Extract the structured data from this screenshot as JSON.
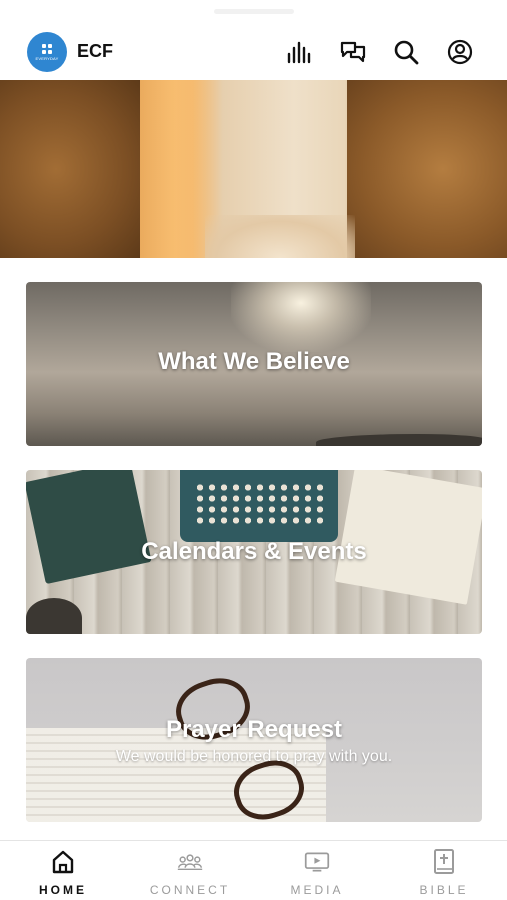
{
  "header": {
    "logo_text": "EVERYDAY",
    "title": "ECF",
    "icons": [
      "stats-icon",
      "chat-icon",
      "search-icon",
      "profile-icon"
    ]
  },
  "cards": [
    {
      "title": "What We Believe",
      "subtitle": ""
    },
    {
      "title": "Calendars & Events",
      "subtitle": ""
    },
    {
      "title": "Prayer Request",
      "subtitle": "We would be honored to pray with you."
    }
  ],
  "tabs": [
    {
      "label": "HOME",
      "icon": "home-icon",
      "active": true
    },
    {
      "label": "CONNECT",
      "icon": "people-icon",
      "active": false
    },
    {
      "label": "MEDIA",
      "icon": "video-icon",
      "active": false
    },
    {
      "label": "BIBLE",
      "icon": "bible-icon",
      "active": false
    }
  ],
  "colors": {
    "accent": "#2f86d1",
    "active_tab": "#111111",
    "inactive_tab": "#9b9b9b"
  }
}
